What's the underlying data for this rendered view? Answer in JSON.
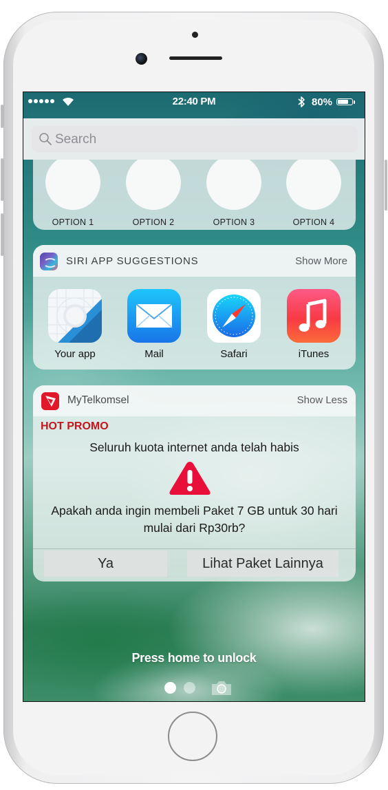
{
  "status_bar": {
    "time": "22:40 PM",
    "battery_percent": "80%",
    "battery_level": 0.8,
    "signal_bars": 5
  },
  "search": {
    "placeholder": "Search"
  },
  "options_widget": {
    "options": [
      "OPTION 1",
      "OPTION 2",
      "OPTION 3",
      "OPTION 4"
    ]
  },
  "siri_widget": {
    "title": "SIRI APP SUGGESTIONS",
    "action": "Show More",
    "apps": [
      {
        "label": "Your app",
        "icon": "your-app-icon"
      },
      {
        "label": "Mail",
        "icon": "mail-icon"
      },
      {
        "label": "Safari",
        "icon": "safari-icon"
      },
      {
        "label": "iTunes",
        "icon": "itunes-icon"
      }
    ]
  },
  "telkomsel_widget": {
    "title": "MyTelkomsel",
    "action": "Show Less",
    "tag": "HOT PROMO",
    "message": "Seluruh kuota internet anda telah habis",
    "question": "Apakah anda ingin membeli Paket 7 GB untuk 30 hari mulai dari Rp30rb?",
    "confirm_button": "Ya",
    "other_button": "Lihat Paket Lainnya",
    "accent_color": "#c4161c"
  },
  "lock_screen": {
    "unlock_hint": "Press home to unlock",
    "page_count": 2,
    "current_page": 1
  }
}
